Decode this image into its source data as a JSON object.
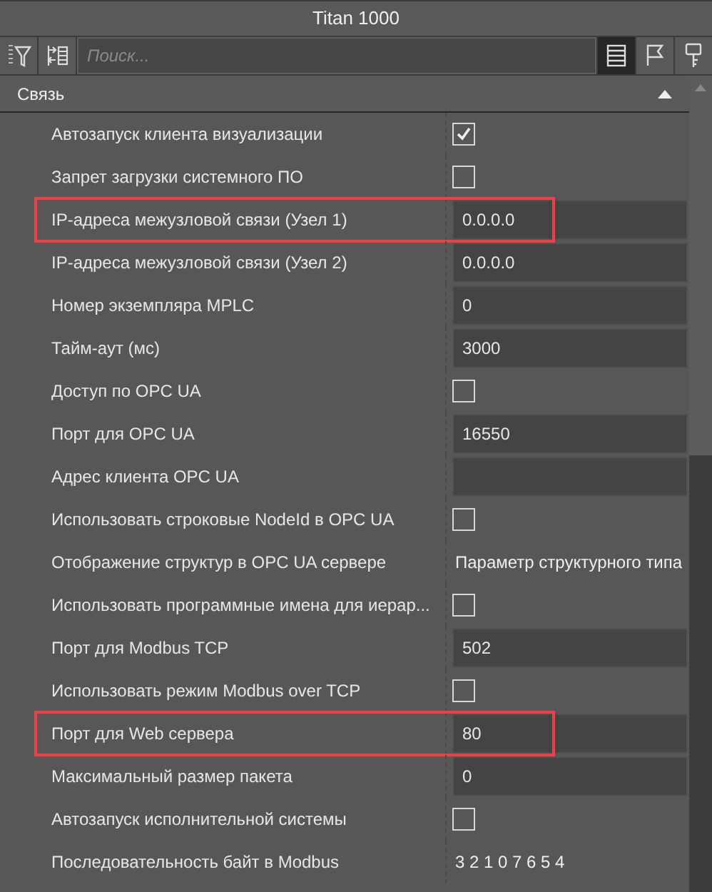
{
  "window": {
    "title": "Titan 1000"
  },
  "toolbar": {
    "search": {
      "placeholder": "Поиск..."
    },
    "view_buttons": [
      {
        "selected": true
      },
      {
        "selected": false
      },
      {
        "selected": false
      }
    ]
  },
  "section": {
    "title": "Связь",
    "expanded": true
  },
  "rows": [
    {
      "label": "Автозапуск клиента визуализации",
      "kind": "checkbox",
      "checked": true,
      "highlighted": false
    },
    {
      "label": "Запрет загрузки системного ПО",
      "kind": "checkbox",
      "checked": false,
      "highlighted": false
    },
    {
      "label": "IP-адреса межузловой связи (Узел 1)",
      "kind": "field",
      "value": "0.0.0.0",
      "highlighted": true
    },
    {
      "label": "IP-адреса межузловой связи (Узел 2)",
      "kind": "field",
      "value": "0.0.0.0",
      "highlighted": false
    },
    {
      "label": "Номер экземпляра MPLC",
      "kind": "field",
      "value": "0",
      "highlighted": false
    },
    {
      "label": "Тайм-аут (мс)",
      "kind": "field",
      "value": "3000",
      "highlighted": false
    },
    {
      "label": "Доступ по OPC UA",
      "kind": "checkbox",
      "checked": false,
      "highlighted": false
    },
    {
      "label": "Порт для OPC UA",
      "kind": "field",
      "value": "16550",
      "highlighted": false
    },
    {
      "label": "Адрес клиента OPC UA",
      "kind": "field",
      "highlighted": false
    },
    {
      "label": "Использовать строковые NodeId в OPC UA",
      "kind": "checkbox",
      "checked": false,
      "highlighted": false
    },
    {
      "label": "Отображение структур в OPC UA сервере",
      "kind": "text",
      "value": "Параметр структурного типа",
      "highlighted": false
    },
    {
      "label": "Использовать программные имена для иерар...",
      "kind": "checkbox",
      "checked": false,
      "highlighted": false
    },
    {
      "label": "Порт для Modbus TCP",
      "kind": "field",
      "value": "502",
      "highlighted": false
    },
    {
      "label": "Использовать режим Modbus over TCP",
      "kind": "checkbox",
      "checked": false,
      "highlighted": false
    },
    {
      "label": "Порт для Web сервера",
      "kind": "field",
      "value": "80",
      "highlighted": true
    },
    {
      "label": "Максимальный размер пакета",
      "kind": "field",
      "value": "0",
      "highlighted": false
    },
    {
      "label": "Автозапуск исполнительной системы",
      "kind": "checkbox",
      "checked": false,
      "highlighted": false
    },
    {
      "label": "Последовательность байт в Modbus",
      "kind": "text",
      "value": "3 2 1 0 7 6 5 4",
      "highlighted": false
    }
  ]
}
